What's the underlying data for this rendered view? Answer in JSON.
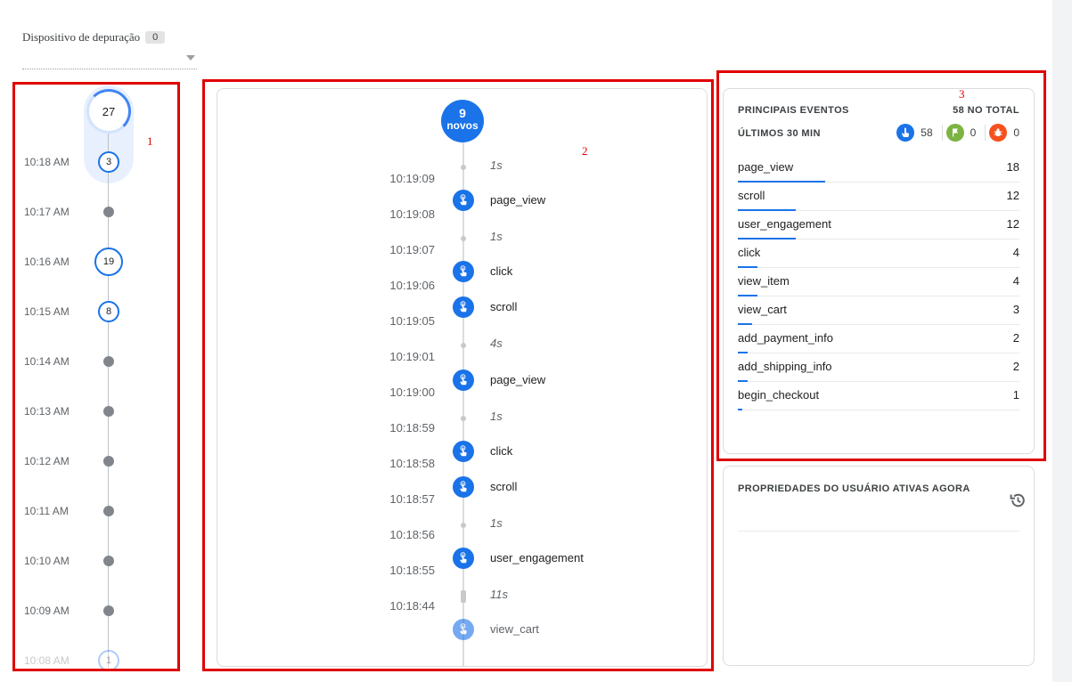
{
  "device": {
    "label": "Dispositivo de depuração",
    "count": "0"
  },
  "annotations": {
    "box1": "1",
    "box2": "2",
    "box3": "3"
  },
  "minutes": {
    "top_count": "27",
    "rows": [
      {
        "time": "10:18 AM",
        "count": "3"
      },
      {
        "time": "10:17 AM"
      },
      {
        "time": "10:16 AM",
        "count": "19"
      },
      {
        "time": "10:15 AM",
        "count": "8"
      },
      {
        "time": "10:14 AM"
      },
      {
        "time": "10:13 AM"
      },
      {
        "time": "10:12 AM"
      },
      {
        "time": "10:11 AM"
      },
      {
        "time": "10:10 AM"
      },
      {
        "time": "10:09 AM"
      },
      {
        "time": "10:08 AM",
        "count": "1"
      }
    ]
  },
  "stream": {
    "new_count": "9",
    "new_label": "novos",
    "items": [
      {
        "kind": "gap",
        "label": "1s"
      },
      {
        "kind": "time",
        "label": "10:19:09"
      },
      {
        "kind": "event",
        "label": "page_view"
      },
      {
        "kind": "time",
        "label": "10:19:08"
      },
      {
        "kind": "gap",
        "label": "1s"
      },
      {
        "kind": "time",
        "label": "10:19:07"
      },
      {
        "kind": "event",
        "label": "click"
      },
      {
        "kind": "time",
        "label": "10:19:06"
      },
      {
        "kind": "event",
        "label": "scroll"
      },
      {
        "kind": "time",
        "label": "10:19:05"
      },
      {
        "kind": "gap",
        "label": "4s"
      },
      {
        "kind": "time",
        "label": "10:19:01"
      },
      {
        "kind": "event",
        "label": "page_view"
      },
      {
        "kind": "time",
        "label": "10:19:00"
      },
      {
        "kind": "gap",
        "label": "1s"
      },
      {
        "kind": "time",
        "label": "10:18:59"
      },
      {
        "kind": "event",
        "label": "click"
      },
      {
        "kind": "time",
        "label": "10:18:58"
      },
      {
        "kind": "event",
        "label": "scroll"
      },
      {
        "kind": "time",
        "label": "10:18:57"
      },
      {
        "kind": "gap",
        "label": "1s"
      },
      {
        "kind": "time",
        "label": "10:18:56"
      },
      {
        "kind": "event",
        "label": "user_engagement"
      },
      {
        "kind": "time",
        "label": "10:18:55"
      },
      {
        "kind": "gap",
        "label": "11s"
      },
      {
        "kind": "time",
        "label": "10:18:44"
      },
      {
        "kind": "event",
        "label": "view_cart"
      }
    ]
  },
  "top_events": {
    "title": "PRINCIPAIS EVENTOS",
    "total": "58 NO TOTAL",
    "subtitle": "ÚLTIMOS 30 MIN",
    "counts": {
      "events": "58",
      "conversions": "0",
      "errors": "0"
    },
    "colors": {
      "events": "#1a73e8",
      "conversions": "#7cb342",
      "errors": "#f4511e"
    },
    "icons": {
      "events": "touch-icon",
      "conversions": "flag-icon",
      "errors": "bug-icon"
    },
    "rows": [
      {
        "name": "page_view",
        "count": "18"
      },
      {
        "name": "scroll",
        "count": "12"
      },
      {
        "name": "user_engagement",
        "count": "12"
      },
      {
        "name": "click",
        "count": "4"
      },
      {
        "name": "view_item",
        "count": "4"
      },
      {
        "name": "view_cart",
        "count": "3"
      },
      {
        "name": "add_payment_info",
        "count": "2"
      },
      {
        "name": "add_shipping_info",
        "count": "2"
      },
      {
        "name": "begin_checkout",
        "count": "1"
      }
    ]
  },
  "user_props": {
    "title": "PROPRIEDADES DO USUÁRIO ATIVAS AGORA",
    "icon": "history-icon"
  }
}
